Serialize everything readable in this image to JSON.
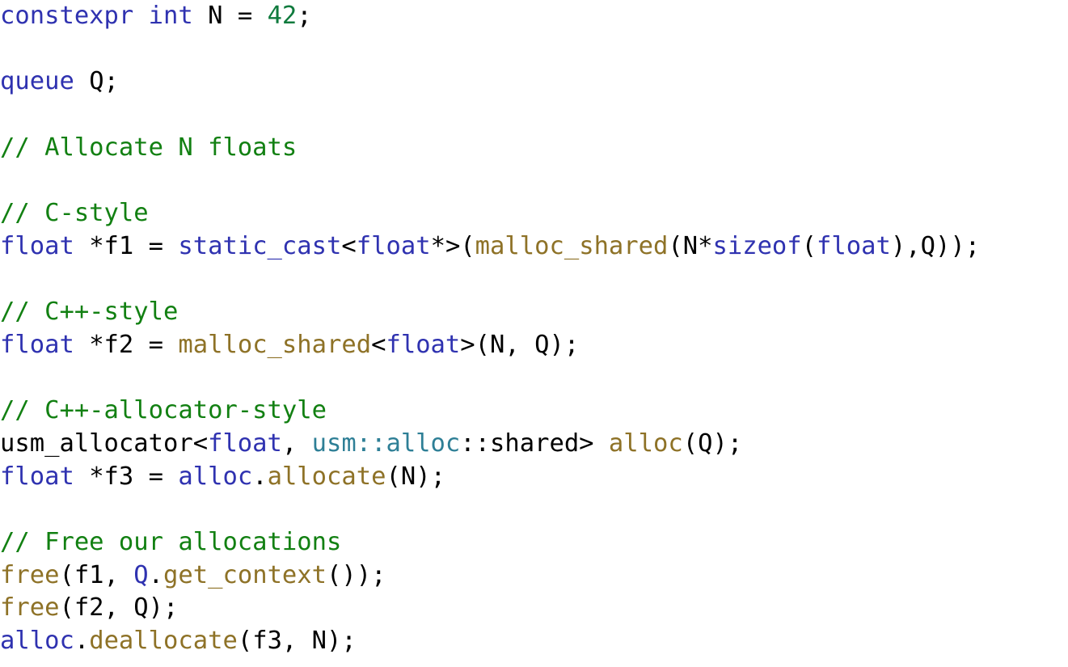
{
  "listing": {
    "language": "C++ (SYCL / DPC++)",
    "font_size_px": 30.5,
    "line_height_px": 40.7,
    "background": "#ffffff",
    "colors": {
      "plain": "#000000",
      "keyword": "#2f32b0",
      "type": "#2f32b0",
      "number": "#0f7a3d",
      "comment": "#128012",
      "function": "#8e7227",
      "namespace": "#2e7f96",
      "variable": "#2f32b0"
    },
    "plain_text": "constexpr int N = 42;\n\nqueue Q;\n\n// Allocate N floats\n\n// C-style\nfloat *f1 = static_cast<float*>(malloc_shared(N*sizeof(float),Q));\n\n// C++-style\nfloat *f2 = malloc_shared<float>(N, Q);\n\n// C++-allocator-style\nusm_allocator<float, usm::alloc::shared> alloc(Q);\nfloat *f3 = alloc.allocate(N);\n\n// Free our allocations\nfree(f1, Q.get_context());\nfree(f2, Q);\nalloc.deallocate(f3, N);",
    "lines": [
      {
        "n": 1,
        "blank": false,
        "tokens": [
          {
            "t": "constexpr",
            "c": "keyword"
          },
          {
            "t": " ",
            "c": "plain"
          },
          {
            "t": "int",
            "c": "keyword"
          },
          {
            "t": " N = ",
            "c": "plain"
          },
          {
            "t": "42",
            "c": "number"
          },
          {
            "t": ";",
            "c": "plain"
          }
        ]
      },
      {
        "n": 2,
        "blank": true,
        "tokens": []
      },
      {
        "n": 3,
        "blank": false,
        "tokens": [
          {
            "t": "queue",
            "c": "keyword"
          },
          {
            "t": " Q;",
            "c": "plain"
          }
        ]
      },
      {
        "n": 4,
        "blank": true,
        "tokens": []
      },
      {
        "n": 5,
        "blank": false,
        "tokens": [
          {
            "t": "// Allocate N floats",
            "c": "comment"
          }
        ]
      },
      {
        "n": 6,
        "blank": true,
        "tokens": []
      },
      {
        "n": 7,
        "blank": false,
        "tokens": [
          {
            "t": "// C-style",
            "c": "comment"
          }
        ]
      },
      {
        "n": 8,
        "blank": false,
        "tokens": [
          {
            "t": "float",
            "c": "type"
          },
          {
            "t": " *f1 = ",
            "c": "plain"
          },
          {
            "t": "static_cast",
            "c": "keyword"
          },
          {
            "t": "<",
            "c": "plain"
          },
          {
            "t": "float",
            "c": "type"
          },
          {
            "t": "*>(",
            "c": "plain"
          },
          {
            "t": "malloc_shared",
            "c": "function"
          },
          {
            "t": "(N*",
            "c": "plain"
          },
          {
            "t": "sizeof",
            "c": "keyword"
          },
          {
            "t": "(",
            "c": "plain"
          },
          {
            "t": "float",
            "c": "type"
          },
          {
            "t": "),Q));",
            "c": "plain"
          }
        ]
      },
      {
        "n": 9,
        "blank": true,
        "tokens": []
      },
      {
        "n": 10,
        "blank": false,
        "tokens": [
          {
            "t": "// C++-style",
            "c": "comment"
          }
        ]
      },
      {
        "n": 11,
        "blank": false,
        "tokens": [
          {
            "t": "float",
            "c": "type"
          },
          {
            "t": " *f2 = ",
            "c": "plain"
          },
          {
            "t": "malloc_shared",
            "c": "function"
          },
          {
            "t": "<",
            "c": "plain"
          },
          {
            "t": "float",
            "c": "type"
          },
          {
            "t": ">(N, Q);",
            "c": "plain"
          }
        ]
      },
      {
        "n": 12,
        "blank": true,
        "tokens": []
      },
      {
        "n": 13,
        "blank": false,
        "tokens": [
          {
            "t": "// C++-allocator-style",
            "c": "comment"
          }
        ]
      },
      {
        "n": 14,
        "blank": false,
        "tokens": [
          {
            "t": "usm_allocator<",
            "c": "plain"
          },
          {
            "t": "float",
            "c": "type"
          },
          {
            "t": ", ",
            "c": "plain"
          },
          {
            "t": "usm::alloc",
            "c": "namespace"
          },
          {
            "t": "::shared> ",
            "c": "plain"
          },
          {
            "t": "alloc",
            "c": "function"
          },
          {
            "t": "(Q);",
            "c": "plain"
          }
        ]
      },
      {
        "n": 15,
        "blank": false,
        "tokens": [
          {
            "t": "float",
            "c": "type"
          },
          {
            "t": " *f3 = ",
            "c": "plain"
          },
          {
            "t": "alloc",
            "c": "variable"
          },
          {
            "t": ".",
            "c": "plain"
          },
          {
            "t": "allocate",
            "c": "function"
          },
          {
            "t": "(N);",
            "c": "plain"
          }
        ]
      },
      {
        "n": 16,
        "blank": true,
        "tokens": []
      },
      {
        "n": 17,
        "blank": false,
        "tokens": [
          {
            "t": "// Free our allocations",
            "c": "comment"
          }
        ]
      },
      {
        "n": 18,
        "blank": false,
        "tokens": [
          {
            "t": "free",
            "c": "function"
          },
          {
            "t": "(f1, ",
            "c": "plain"
          },
          {
            "t": "Q",
            "c": "variable"
          },
          {
            "t": ".",
            "c": "plain"
          },
          {
            "t": "get_context",
            "c": "function"
          },
          {
            "t": "());",
            "c": "plain"
          }
        ]
      },
      {
        "n": 19,
        "blank": false,
        "tokens": [
          {
            "t": "free",
            "c": "function"
          },
          {
            "t": "(f2, Q);",
            "c": "plain"
          }
        ]
      },
      {
        "n": 20,
        "blank": false,
        "tokens": [
          {
            "t": "alloc",
            "c": "variable"
          },
          {
            "t": ".",
            "c": "plain"
          },
          {
            "t": "deallocate",
            "c": "function"
          },
          {
            "t": "(f3, N);",
            "c": "plain"
          }
        ]
      }
    ]
  }
}
